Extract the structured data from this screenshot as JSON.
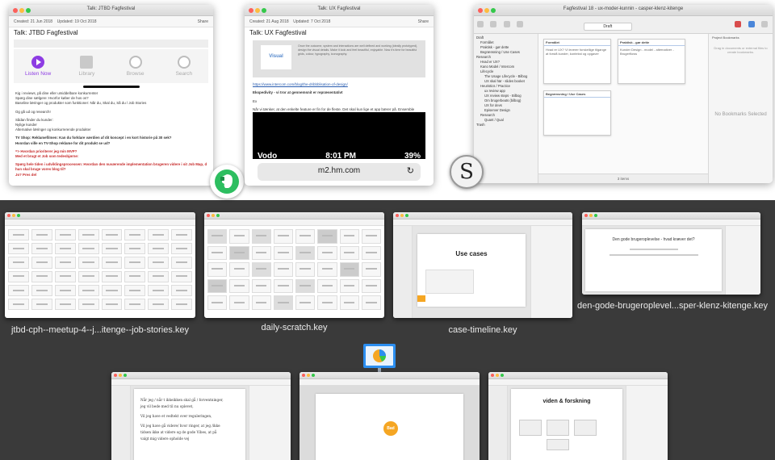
{
  "evernote_window": {
    "title": "Talk: JTBD Fagfestival",
    "created": "Created: 21 Jun 2018",
    "updated": "Updated: 19 Oct 2018",
    "share": "Share",
    "note_title": "Talk: JTBD Fagfestival",
    "player_tabs": [
      {
        "label": "Listen Now",
        "icon": "play-icon"
      },
      {
        "label": "Library",
        "icon": "library-icon"
      },
      {
        "label": "Browse",
        "icon": "radio-icon"
      },
      {
        "label": "Search",
        "icon": "search-icon"
      }
    ],
    "lines": [
      "Kig i reviews, på dine eller umiddelbare konkurrenter",
      "Spørg dine sælgere: Hvorfor køber de hos os?",
      "Baseline læringer og produkter som funktioner: Når du, Skal du, Så du / Job Stories",
      "Og gå ud og research!",
      "Sådan finder du kunder:",
      "Nylige kunder",
      "Alternative læringer og konkurrerende produkter",
      "TV Shop: Reklamefilmen: Kan du forklare værdien af dit koncept i en kort historie på 30 sek?",
      "Hvordan ville en TV-Shop reklame for dit produkt se ud?",
      "=> Hvordan prioriterer jeg min MVP?",
      "Med et brugt et Job som tedesbjørne:",
      "Spørg hele tiden i udviklingsprocessen: Hvordan den nuværende implementation brugeren videre i sit Job Map, del",
      "hun skal bruge vores blog til?",
      "Jo? Pres del"
    ]
  },
  "ux_window": {
    "title": "Talk: UX Fagfestival",
    "created": "Created: 21 Aug 2018",
    "updated": "Updated: 7 Oct 2018",
    "share": "Share",
    "note_title": "Talk: UX Fagfestival",
    "card_label": "Visual",
    "card_desc": "Once the outcome, system and interactions are well defined and working (ideally prototyped), design the visual details. Make it look and feel beautiful, enjoyable. Now it's time for beautiful grids, colour, typography, iconography.",
    "link": "https://www.intercom.com/blog/the-dribbblisation-of-design/",
    "heading": "Ekspedivity - vi tror at gennemsnit er repræsentativt",
    "line1": "Ex",
    "line2": "Når vi tænker, at den enkelte feature er fin for de fleste. Det skal kun lige et app bærer på. Ensemble probability",
    "line3": "Men glemmer at tage højde for den enkelte brugeroplevelse. Når et nyt device fx besøger sitet og får det her:",
    "phone_carrier": "Vodo",
    "phone_time": "8:01 PM",
    "phone_battery": "39%",
    "phone_url": "m2.hm.com"
  },
  "scrivener_window": {
    "title": "Fagfestival 18 - ux-moder-kunnin - casper-klenz-kitenge",
    "view_label": "Draft",
    "binder": [
      {
        "label": "Draft",
        "level": 0
      },
      {
        "label": "Formålet",
        "level": 1
      },
      {
        "label": "Praktisk - gør dette",
        "level": 1
      },
      {
        "label": "Begrænsning / Use Cases",
        "level": 1
      },
      {
        "label": "Research",
        "level": 0
      },
      {
        "label": "Hvad er UX?",
        "level": 1
      },
      {
        "label": "Kano Model / Intercom",
        "level": 1
      },
      {
        "label": "Lifecycle",
        "level": 0
      },
      {
        "label": "The Usage Lifecycle - Bilbog",
        "level": 1
      },
      {
        "label": "UX skal här - slides booket",
        "level": 1
      },
      {
        "label": "Heuristics / Practice",
        "level": 0
      },
      {
        "label": "ux review app",
        "level": 1
      },
      {
        "label": "UX review steps - Bilbog",
        "level": 1
      },
      {
        "label": "Om brugerbeats (bilbog)",
        "level": 1
      },
      {
        "label": "UX for devs",
        "level": 1
      },
      {
        "label": "Episerver Design",
        "level": 1
      },
      {
        "label": "Research",
        "level": 0
      },
      {
        "label": "Quant / Qual",
        "level": 1
      },
      {
        "label": "Trash",
        "level": 0
      }
    ],
    "cards": [
      {
        "title": "Formålet",
        "body": "Hvad er UX? Vi leverer forskellige tilgange at forstå kunder, kontekst og opgaver"
      },
      {
        "title": "Praktisk - gør dette",
        "body": "Kunder Design - model - alternativer - Brugerflows"
      },
      {
        "title": "Begrænsning / Use Cases",
        "body": ""
      }
    ],
    "inspector_title": "Project Bookmarks",
    "inspector_hint": "Drag in documents or external files to create bookmarks.",
    "no_bookmarks": "No Bookmarks Selected",
    "footer": "3 items"
  },
  "keynote_docs": [
    {
      "label": "jtbd-cph--meetup-4--j...itenge--job-stories.key"
    },
    {
      "label": "daily-scratch.key"
    },
    {
      "label": "case-timeline.key",
      "slide_title": "Use cases"
    },
    {
      "label": "den-gode-brugeroplevel...sper-klenz-kitenge.key",
      "slide_title": "Den gode brugeroplevelse - hvad kræver det?"
    },
    {
      "label": "",
      "slide_lines": [
        "Når jeg / når t ikkeikken skal gå / forventninger,",
        "jeg vil bede med til nu oplevet,",
        "Vil jeg have et vedtekt over reguleringen,",
        "Vil jeg have gå videre/ hvor ringer, at jeg /ikke",
        "tidsen ikke at videre og de gode Vibes, at på",
        "valgt mig videre opholde vej"
      ]
    },
    {
      "label": "",
      "slide_logo": "Bad"
    },
    {
      "label": "",
      "slide_title": "viden & forskning"
    }
  ],
  "colors": {
    "evernote_green": "#2dbe60",
    "podcast_purple": "#8d3ce3",
    "keynote_blue": "#2b8ef0"
  }
}
